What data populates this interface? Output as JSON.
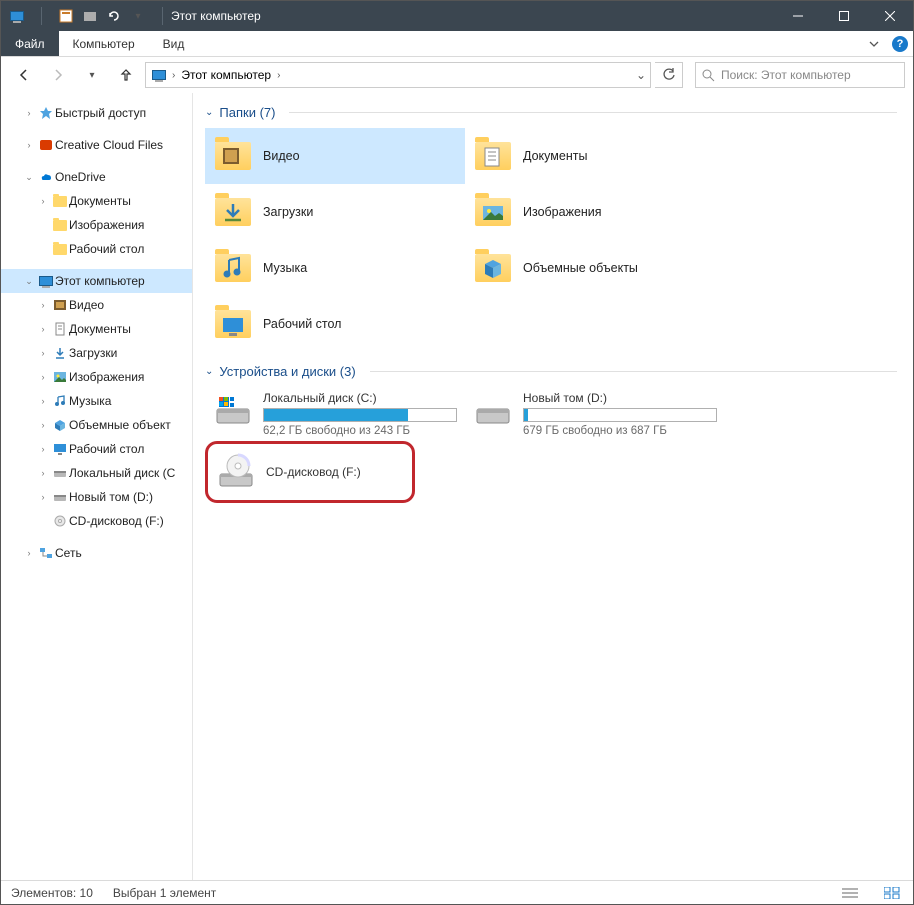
{
  "title": "Этот компьютер",
  "ribbon": {
    "file": "Файл",
    "computer": "Компьютер",
    "view": "Вид"
  },
  "breadcrumb": {
    "current": "Этот компьютер"
  },
  "search": {
    "placeholder": "Поиск: Этот компьютер"
  },
  "tree": {
    "quick": "Быстрый доступ",
    "ccf": "Creative Cloud Files",
    "onedrive": "OneDrive",
    "od_docs": "Документы",
    "od_images": "Изображения",
    "od_desktop": "Рабочий стол",
    "thispc": "Этот компьютер",
    "pc_video": "Видео",
    "pc_docs": "Документы",
    "pc_downloads": "Загрузки",
    "pc_images": "Изображения",
    "pc_music": "Музыка",
    "pc_3d": "Объемные объект",
    "pc_desktop": "Рабочий стол",
    "pc_diskc": "Локальный диск (C",
    "pc_diskd": "Новый том (D:)",
    "pc_cdrom": "CD-дисковод (F:)",
    "network": "Сеть"
  },
  "groups": {
    "folders_title": "Папки (7)",
    "drives_title": "Устройства и диски (3)"
  },
  "folders": {
    "video": "Видео",
    "docs": "Документы",
    "downloads": "Загрузки",
    "images": "Изображения",
    "music": "Музыка",
    "objects3d": "Объемные объекты",
    "desktop": "Рабочий стол"
  },
  "drives": {
    "c_name": "Локальный диск (C:)",
    "c_sub": "62,2 ГБ свободно из 243 ГБ",
    "c_pct": 75,
    "d_name": "Новый том (D:)",
    "d_sub": "679 ГБ свободно из 687 ГБ",
    "d_pct": 2,
    "f_name": "CD-дисковод (F:)"
  },
  "status": {
    "items": "Элементов: 10",
    "selected": "Выбран 1 элемент"
  }
}
